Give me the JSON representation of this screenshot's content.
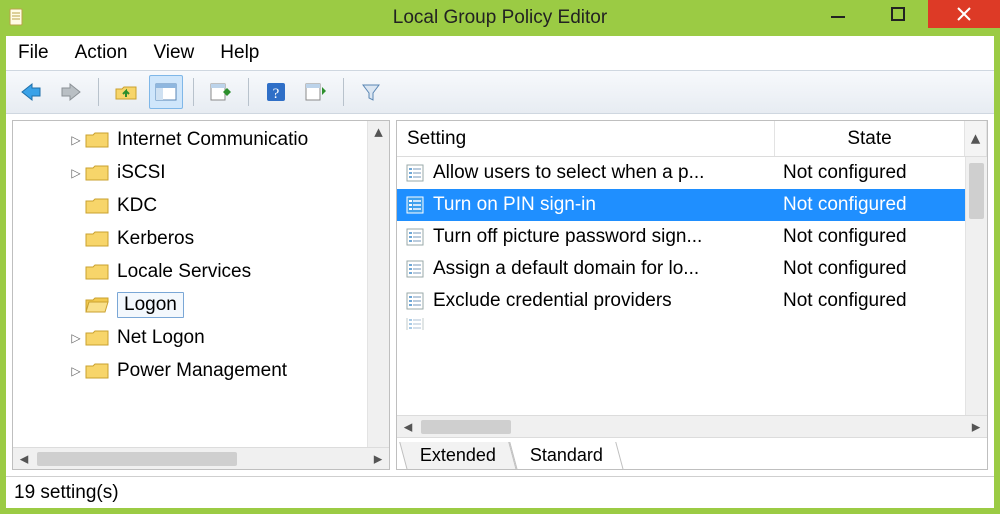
{
  "window": {
    "title": "Local Group Policy Editor"
  },
  "menubar": [
    "File",
    "Action",
    "View",
    "Help"
  ],
  "toolbar": {
    "icons": [
      "back",
      "forward",
      "up-folder",
      "details-pane",
      "export",
      "help",
      "properties",
      "filter"
    ]
  },
  "tree": {
    "items": [
      {
        "label": "Internet Communicatio",
        "expandable": true,
        "selected": false,
        "truncated": true
      },
      {
        "label": "iSCSI",
        "expandable": true,
        "selected": false
      },
      {
        "label": "KDC",
        "expandable": false,
        "selected": false
      },
      {
        "label": "Kerberos",
        "expandable": false,
        "selected": false
      },
      {
        "label": "Locale Services",
        "expandable": false,
        "selected": false
      },
      {
        "label": "Logon",
        "expandable": false,
        "selected": true
      },
      {
        "label": "Net Logon",
        "expandable": true,
        "selected": false
      },
      {
        "label": "Power Management",
        "expandable": true,
        "selected": false
      }
    ]
  },
  "grid": {
    "columns": {
      "setting": "Setting",
      "state": "State"
    },
    "rows": [
      {
        "setting": "Allow users to select when a p...",
        "state": "Not configured",
        "selected": false
      },
      {
        "setting": "Turn on PIN sign-in",
        "state": "Not configured",
        "selected": true
      },
      {
        "setting": "Turn off picture password sign...",
        "state": "Not configured",
        "selected": false
      },
      {
        "setting": "Assign a default domain for lo...",
        "state": "Not configured",
        "selected": false
      },
      {
        "setting": "Exclude credential providers",
        "state": "Not configured",
        "selected": false
      }
    ]
  },
  "tabs": {
    "extended": "Extended",
    "standard": "Standard",
    "active": "Standard"
  },
  "status": "19 setting(s)"
}
